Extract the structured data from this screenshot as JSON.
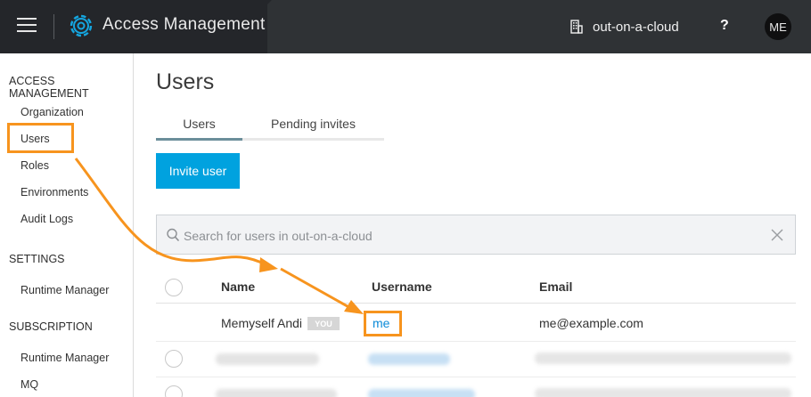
{
  "header": {
    "app_title": "Access Management",
    "org_name": "out-on-a-cloud",
    "help_label": "?",
    "avatar_initials": "ME"
  },
  "sidebar": {
    "sections": [
      {
        "heading": "ACCESS MANAGEMENT",
        "items": [
          "Organization",
          "Users",
          "Roles",
          "Environments",
          "Audit Logs"
        ]
      },
      {
        "heading": "SETTINGS",
        "items": [
          "Runtime Manager"
        ]
      },
      {
        "heading": "SUBSCRIPTION",
        "items": [
          "Runtime Manager",
          "MQ"
        ]
      }
    ],
    "active_item": "Users"
  },
  "main": {
    "title": "Users",
    "tabs": [
      {
        "label": "Users",
        "active": true
      },
      {
        "label": "Pending invites",
        "active": false
      }
    ],
    "invite_button": "Invite user",
    "search": {
      "placeholder": "Search for users in out-on-a-cloud",
      "value": ""
    },
    "table": {
      "columns": [
        "Name",
        "Username",
        "Email"
      ],
      "rows": [
        {
          "name": "Memyself Andi",
          "badge": "YOU",
          "username": "me",
          "email": "me@example.com"
        }
      ]
    }
  },
  "colors": {
    "topbar": "#24262a",
    "accent": "#00a2df",
    "link": "#0a8ad8",
    "highlight": "#f7941e",
    "tab_underline": "#6b8e9a"
  },
  "icons": [
    "menu-icon",
    "settings-gear-logo",
    "building-icon",
    "search-icon",
    "close-icon"
  ]
}
